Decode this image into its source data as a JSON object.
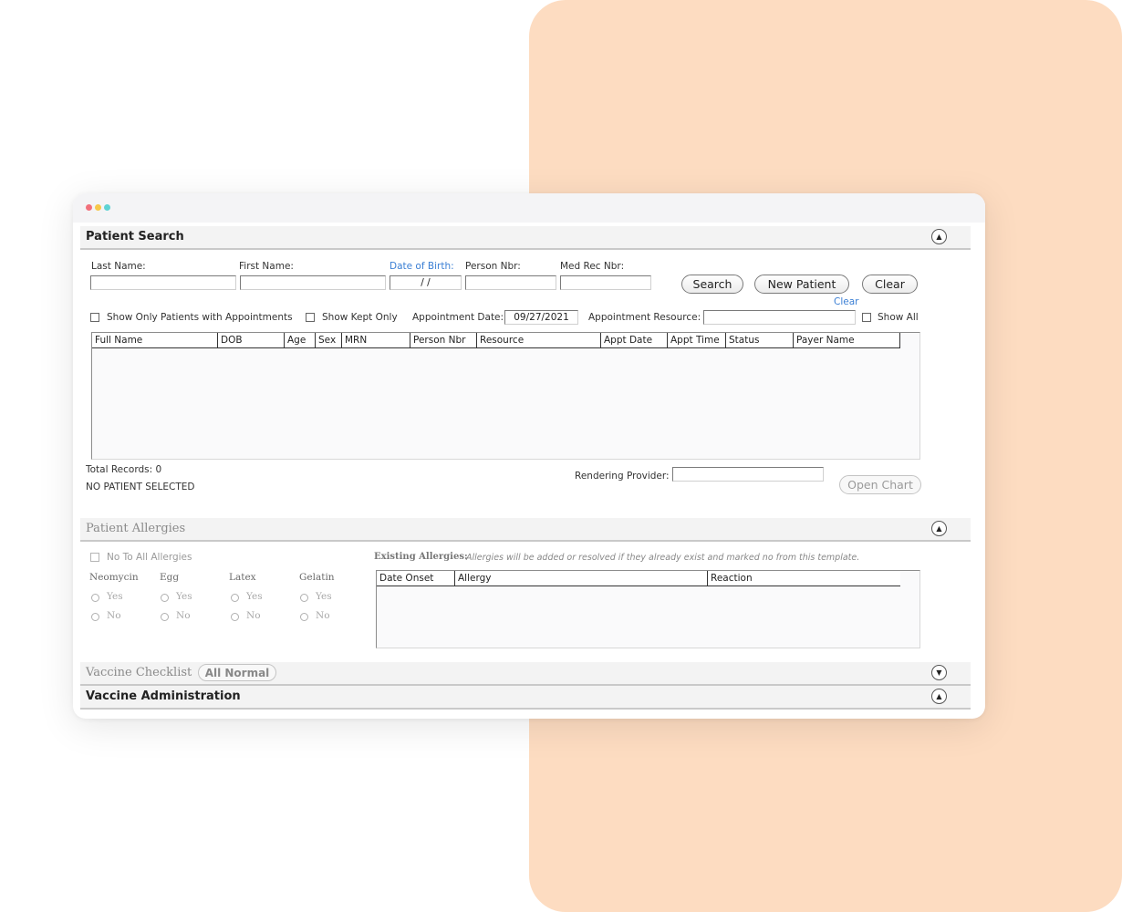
{
  "patient_search": {
    "title": "Patient Search",
    "last_name_label": "Last Name:",
    "first_name_label": "First Name:",
    "dob_label": "Date of Birth:",
    "dob_value": "/ /",
    "person_nbr_label": "Person Nbr:",
    "med_rec_label": "Med Rec Nbr:",
    "search_button": "Search",
    "new_patient_button": "New Patient",
    "clear_button": "Clear",
    "clear_link": "Clear",
    "show_only_appts_label": "Show Only Patients with Appointments",
    "show_kept_only_label": "Show Kept Only",
    "appt_date_label": "Appointment Date:",
    "appt_date_value": "09/27/2021",
    "appt_resource_label": "Appointment Resource:",
    "show_all_label": "Show All",
    "columns": [
      "Full Name",
      "DOB",
      "Age",
      "Sex",
      "MRN",
      "Person Nbr",
      "Resource",
      "Appt Date",
      "Appt Time",
      "Status",
      "Payer Name"
    ],
    "total_records": "Total Records: 0",
    "no_patient_selected": "NO PATIENT SELECTED",
    "rendering_provider_label": "Rendering Provider:",
    "open_chart_button": "Open Chart"
  },
  "patient_allergies": {
    "title": "Patient Allergies",
    "no_to_all_label": "No To All Allergies",
    "allergens": [
      "Neomycin",
      "Egg",
      "Latex",
      "Gelatin"
    ],
    "yes_label": "Yes",
    "no_label": "No",
    "existing_label": "Existing Allergies:",
    "existing_note": "Allergies will be added or resolved if they already exist and marked no from this template.",
    "columns": [
      "Date Onset",
      "Allergy",
      "Reaction"
    ]
  },
  "vaccine_checklist": {
    "title": "Vaccine Checklist",
    "all_normal_button": "All Normal"
  },
  "vaccine_administration": {
    "title": "Vaccine Administration"
  },
  "colors": {
    "background_accent": "#fddcc1",
    "link_blue": "#3b7fd4"
  }
}
